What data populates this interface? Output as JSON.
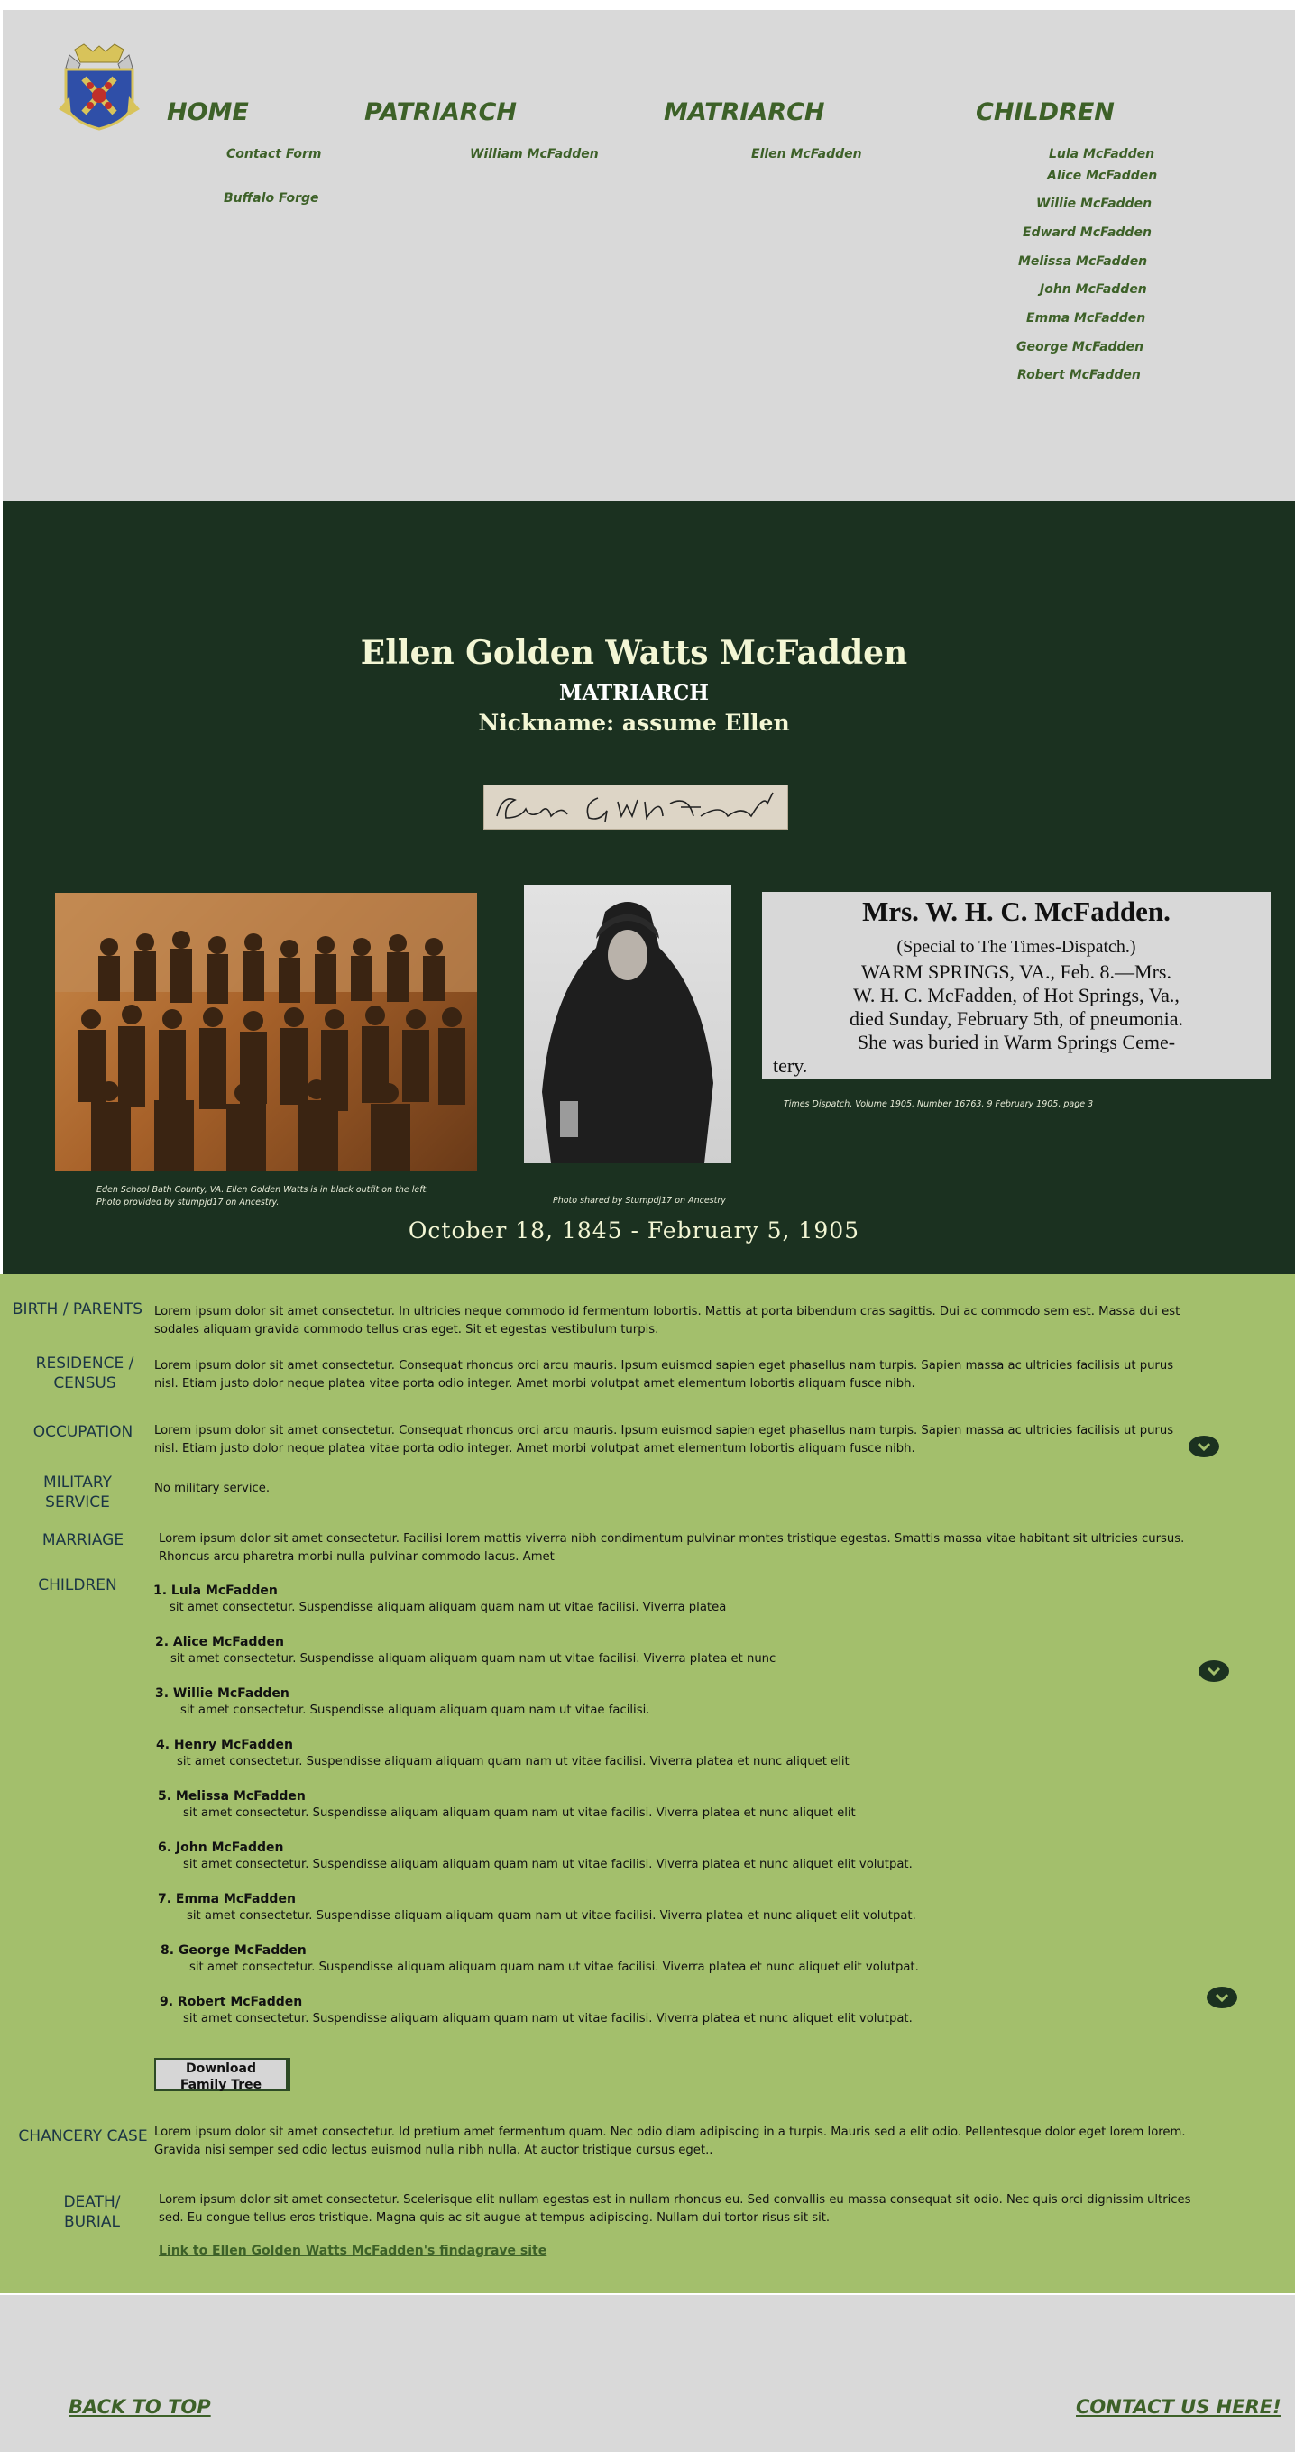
{
  "nav": {
    "home": {
      "label": "HOME",
      "items": [
        "Contact Form",
        "Buffalo Forge"
      ]
    },
    "patriarch": {
      "label": "PATRIARCH",
      "items": [
        "William McFadden"
      ]
    },
    "matriarch": {
      "label": "MATRIARCH",
      "items": [
        "Ellen McFadden"
      ]
    },
    "children": {
      "label": "CHILDREN",
      "items": [
        "Lula McFadden",
        "Alice McFadden",
        "Willie McFadden",
        "Edward McFadden",
        "Melissa McFadden",
        "John McFadden",
        "Emma McFadden",
        "George McFadden",
        "Robert McFadden"
      ]
    }
  },
  "hero": {
    "name": "Ellen Golden Watts McFadden",
    "role": "MATRIARCH",
    "nickname": "Nickname:  assume Ellen",
    "signature": "Ellen G.W.McFadden",
    "school_caption_1": "Eden School Bath County, VA.  Ellen Golden Watts is in black outfit on the left.",
    "school_caption_2": "Photo provided by stumpjd17 on Ancestry.",
    "portrait_caption": "Photo shared by Stumpdj17 on Ancestry",
    "news_headline": "Mrs. W. H. C. McFadden.",
    "news_line1": "(Special to The Times-Dispatch.)",
    "news_line2": "WARM SPRINGS, VA., Feb. 8.—Mrs.",
    "news_line3": "W. H. C. McFadden, of Hot Springs, Va.,",
    "news_line4": "died Sunday, February 5th, of pneumonia.",
    "news_line5": "She was buried in Warm Springs Ceme-",
    "news_line6": "tery.",
    "news_caption": "Times Dispatch, Volume 1905, Number 16763,  9 February 1905, page 3",
    "dates": "October 18, 1845 - February 5, 1905"
  },
  "bio": {
    "birth": {
      "label": "BIRTH / PARENTS",
      "text": "Lorem ipsum dolor sit amet consectetur. In ultricies neque commodo id fermentum lobortis. Mattis at porta bibendum cras sagittis. Dui ac commodo sem est. Massa dui est sodales aliquam gravida commodo tellus cras eget. Sit et egestas vestibulum turpis."
    },
    "residence": {
      "label": "RESIDENCE / CENSUS",
      "text": "Lorem ipsum dolor sit amet consectetur. Consequat rhoncus orci arcu mauris. Ipsum euismod sapien eget phasellus nam turpis. Sapien massa ac ultricies facilisis ut purus nisl. Etiam justo dolor neque platea vitae porta odio integer. Amet morbi volutpat amet elementum lobortis aliquam fusce nibh."
    },
    "occupation": {
      "label": "OCCUPATION",
      "text": "Lorem ipsum dolor sit amet consectetur. Consequat rhoncus orci arcu mauris. Ipsum euismod sapien eget phasellus nam turpis. Sapien massa ac ultricies facilisis ut purus nisl. Etiam justo dolor neque platea vitae porta odio integer. Amet morbi volutpat amet elementum lobortis aliquam fusce nibh."
    },
    "military": {
      "label": "MILITARY SERVICE",
      "text": "No military service."
    },
    "marriage": {
      "label": "MARRIAGE",
      "text": "Lorem ipsum dolor sit amet consectetur. Facilisi lorem mattis viverra nibh condimentum pulvinar montes tristique egestas. Smattis massa vitae habitant sit ultricies cursus. Rhoncus arcu pharetra morbi nulla pulvinar commodo lacus. Amet"
    },
    "children_label": "CHILDREN",
    "children": [
      {
        "name": "1. Lula McFadden",
        "desc": "sit amet consectetur. Suspendisse aliquam aliquam quam nam ut vitae facilisi. Viverra platea"
      },
      {
        "name": "2.  Alice McFadden",
        "desc": "sit amet consectetur. Suspendisse aliquam aliquam quam nam ut vitae facilisi. Viverra platea et nunc"
      },
      {
        "name": "3.  Willie McFadden",
        "desc": "sit amet consectetur. Suspendisse aliquam aliquam quam nam ut vitae facilisi."
      },
      {
        "name": "4. Henry McFadden",
        "desc": "sit amet consectetur. Suspendisse aliquam aliquam quam nam ut vitae facilisi. Viverra platea et nunc aliquet elit"
      },
      {
        "name": "5.  Melissa McFadden",
        "desc": "sit amet consectetur. Suspendisse aliquam aliquam quam nam ut vitae facilisi. Viverra platea et nunc aliquet elit"
      },
      {
        "name": "6. John McFadden",
        "desc": "sit amet consectetur. Suspendisse aliquam aliquam quam nam ut vitae facilisi. Viverra platea et nunc aliquet elit volutpat."
      },
      {
        "name": "7.  Emma McFadden",
        "desc": "sit amet consectetur. Suspendisse aliquam aliquam quam nam ut vitae facilisi. Viverra platea et nunc aliquet elit volutpat."
      },
      {
        "name": "8.  George McFadden",
        "desc": "sit amet consectetur. Suspendisse aliquam aliquam quam nam ut vitae facilisi. Viverra platea et nunc aliquet elit volutpat."
      },
      {
        "name": "9.  Robert  McFadden",
        "desc": "sit amet consectetur. Suspendisse aliquam aliquam quam nam ut vitae facilisi. Viverra platea et nunc aliquet elit volutpat."
      }
    ],
    "download_label_1": "Download",
    "download_label_2": "Family Tree",
    "chancery": {
      "label": "CHANCERY CASE",
      "text": "Lorem ipsum dolor sit amet consectetur. Id pretium amet fermentum quam. Nec odio diam adipiscing in a turpis. Mauris sed a elit odio. Pellentesque dolor eget lorem lorem. Gravida nisi semper sed odio lectus euismod nulla nibh nulla. At auctor tristique cursus eget.."
    },
    "death": {
      "label": "DEATH/ BURIAL",
      "text": "Lorem ipsum dolor sit amet consectetur. Scelerisque elit nullam egestas est in nullam rhoncus eu. Sed convallis eu massa consequat sit odio. Nec quis orci dignissim ultrices sed. Eu congue tellus eros tristique. Magna quis ac sit augue at tempus adipiscing. Nullam dui tortor risus sit sit."
    },
    "findagrave_link": "Link to Ellen Golden Watts McFadden's findagrave site"
  },
  "footer": {
    "back_to_top": "BACK TO TOP",
    "contact": "CONTACT US HERE!"
  },
  "colors": {
    "nav_green": "#3d6128",
    "hero_bg": "#1b3120",
    "bio_bg": "#a3bf6c",
    "grey_bg": "#d9d9d9",
    "label_blue": "#1b3545"
  }
}
